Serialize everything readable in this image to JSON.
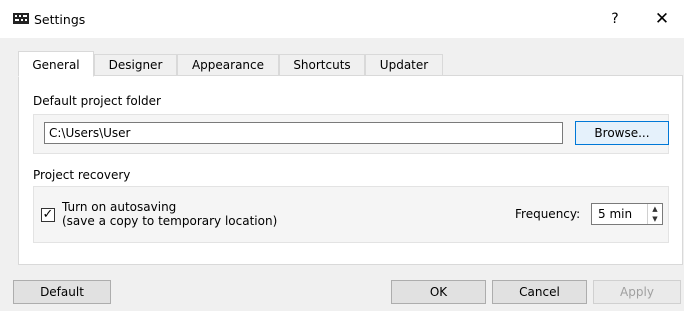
{
  "window": {
    "title": "Settings",
    "help_label": "?",
    "close_label": "✕"
  },
  "tabs": [
    {
      "label": "General",
      "active": true
    },
    {
      "label": "Designer",
      "active": false
    },
    {
      "label": "Appearance",
      "active": false
    },
    {
      "label": "Shortcuts",
      "active": false
    },
    {
      "label": "Updater",
      "active": false
    }
  ],
  "general": {
    "default_folder_label": "Default project folder",
    "folder_path": "C:\\Users\\User",
    "browse_label": "Browse...",
    "recovery_label": "Project recovery",
    "autosave_checked": true,
    "checkbox_mark": "✓",
    "autosave_label_line1": "Turn on autosaving",
    "autosave_label_line2": "(save a copy to temporary location)",
    "frequency_label": "Frequency:",
    "frequency_value": "5 min"
  },
  "footer": {
    "default_label": "Default",
    "ok_label": "OK",
    "cancel_label": "Cancel",
    "apply_label": "Apply",
    "apply_enabled": false
  },
  "colors": {
    "accent": "#0078d7",
    "window_bg": "#f0f0f0",
    "panel_bg": "#ffffff"
  },
  "icons": {
    "app": "app-logo-icon",
    "help": "help-icon",
    "close": "close-icon",
    "spin_up": "chevron-up-icon",
    "spin_down": "chevron-down-icon"
  }
}
